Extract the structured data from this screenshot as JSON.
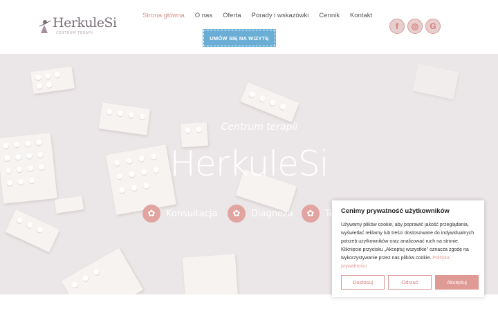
{
  "header": {
    "logo_name": "HerkuleSi",
    "logo_tagline": "CENTRUM TERAPII",
    "nav": [
      {
        "label": "Strona główna",
        "active": true
      },
      {
        "label": "O nas",
        "active": false
      },
      {
        "label": "Oferta",
        "active": false
      },
      {
        "label": "Porady i wskazówki",
        "active": false
      },
      {
        "label": "Cennik",
        "active": false
      },
      {
        "label": "Kontakt",
        "active": false
      }
    ],
    "cta_label": "UMÓW SIĘ NA WIZYTĘ",
    "social": [
      {
        "icon": "facebook-icon",
        "glyph": "f"
      },
      {
        "icon": "instagram-icon",
        "glyph": "◎"
      },
      {
        "icon": "google-icon",
        "glyph": "G"
      }
    ]
  },
  "hero": {
    "subtitle": "Centrum terapii",
    "title": "HerkuleSi",
    "services": [
      {
        "label": "Konsultacja",
        "icon": "flower-icon"
      },
      {
        "label": "Diagnoza",
        "icon": "flower-icon"
      },
      {
        "label": "Te",
        "icon": "flower-icon"
      }
    ]
  },
  "cookie": {
    "title": "Cenimy prywatność użytkowników",
    "text": "Używamy plików cookie, aby poprawić jakość przeglądania, wyświetlać reklamy lub treści dostosowane do indywidualnych potrzeb użytkowników oraz analizować ruch na stronie. Kliknięcie przycisku „Akceptuj wszystkie” oznacza zgodę na wykorzystywanie przez nas plików cookie.",
    "link": "Polityka prywatności",
    "buttons": {
      "customize": "Dostosuj",
      "reject": "Odrzuć",
      "accept": "Akceptuj"
    }
  },
  "colors": {
    "accent": "#e09a95",
    "nav_active": "#d6918a",
    "cta": "#6aaed6",
    "hero_bg": "#ebe6e7"
  }
}
